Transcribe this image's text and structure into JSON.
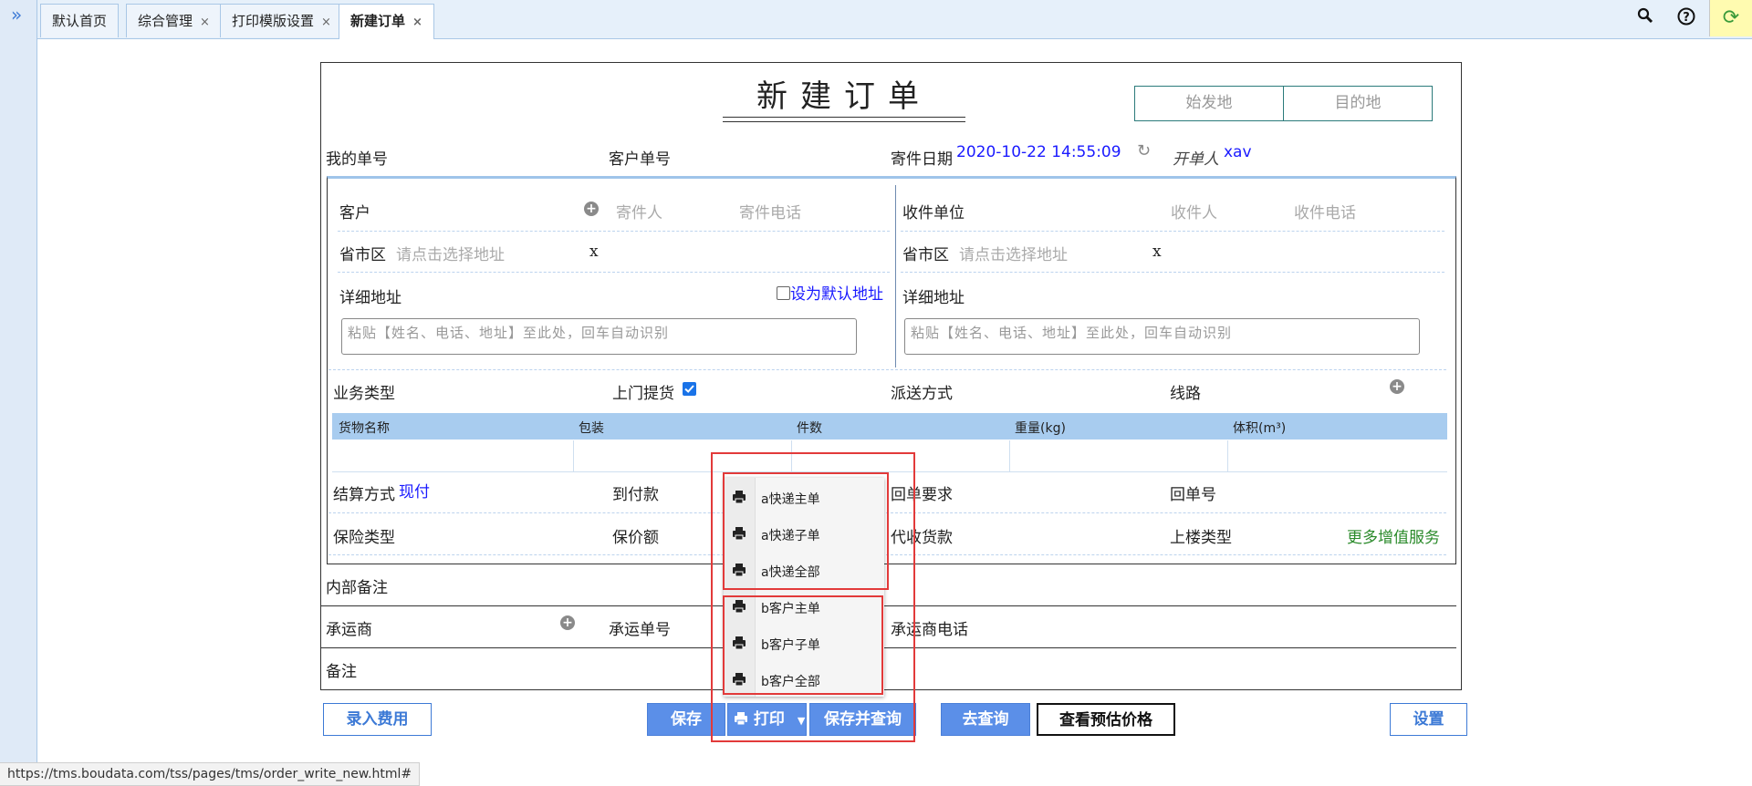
{
  "tabs": [
    {
      "label": "默认首页",
      "closable": false
    },
    {
      "label": "综合管理",
      "closable": true
    },
    {
      "label": "打印模版设置",
      "closable": true
    },
    {
      "label": "新建订单",
      "closable": true,
      "active": true
    }
  ],
  "toolbar": {
    "close_glyph": "×",
    "icons": [
      "search-icon",
      "help-icon",
      "refresh-icon"
    ]
  },
  "form": {
    "title": "新建订单",
    "route": {
      "origin_placeholder": "始发地",
      "destination_placeholder": "目的地"
    },
    "my_order_no_label": "我的单号",
    "customer_order_no_label": "客户单号",
    "ship_date_label": "寄件日期",
    "ship_date_value": "2020-10-22 14:55:09",
    "creator_label": "开单人",
    "creator_value": "xav",
    "sender": {
      "customer_label": "客户",
      "sender_placeholder": "寄件人",
      "sender_phone_placeholder": "寄件电话",
      "region_label": "省市区",
      "region_placeholder": "请点击选择地址",
      "clear_glyph": "x",
      "detail_label": "详细地址",
      "default_address_label": "设为默认地址",
      "paste_placeholder": "粘贴【姓名、电话、地址】至此处，回车自动识别"
    },
    "receiver": {
      "unit_label": "收件单位",
      "receiver_placeholder": "收件人",
      "receiver_phone_placeholder": "收件电话",
      "region_label": "省市区",
      "region_placeholder": "请点击选择地址",
      "clear_glyph": "x",
      "detail_label": "详细地址",
      "paste_placeholder": "粘贴【姓名、电话、地址】至此处，回车自动识别"
    },
    "business_type_label": "业务类型",
    "pickup_label": "上门提货",
    "pickup_checked": true,
    "delivery_method_label": "派送方式",
    "route_label": "线路",
    "goods_columns": [
      "货物名称",
      "包装",
      "件数",
      "重量(kg)",
      "体积(m³)"
    ],
    "settlement_label": "结算方式",
    "settlement_value": "现付",
    "cod_label": "到付款",
    "receipt_req_label": "回单要求",
    "receipt_no_label": "回单号",
    "insurance_type_label": "保险类型",
    "insured_amount_label": "保价额",
    "collect_payment_label": "代收货款",
    "stairs_type_label": "上楼类型",
    "more_services_label": "更多增值服务",
    "internal_note_label": "内部备注",
    "carrier_label": "承运商",
    "carrier_no_label": "承运单号",
    "carrier_phone_label": "承运商电话",
    "note_label": "备注"
  },
  "buttons": {
    "enter_fee": "录入费用",
    "save": "保存",
    "print": "打印",
    "save_query": "保存并查询",
    "query": "去查询",
    "estimate": "查看预估价格",
    "settings": "设置"
  },
  "print_menu": [
    {
      "label": "a快递主单"
    },
    {
      "label": "a快递子单"
    },
    {
      "label": "a快递全部"
    },
    {
      "label": "b客户主单"
    },
    {
      "label": "b客户子单"
    },
    {
      "label": "b客户全部"
    }
  ],
  "status_url": "https://tms.boudata.com/tss/pages/tms/order_write_new.html#",
  "colors": {
    "accent": "#5b8fe8",
    "link_blue": "#1a1aff",
    "green": "#2a8a2a",
    "highlight_red": "#e23a3a"
  }
}
